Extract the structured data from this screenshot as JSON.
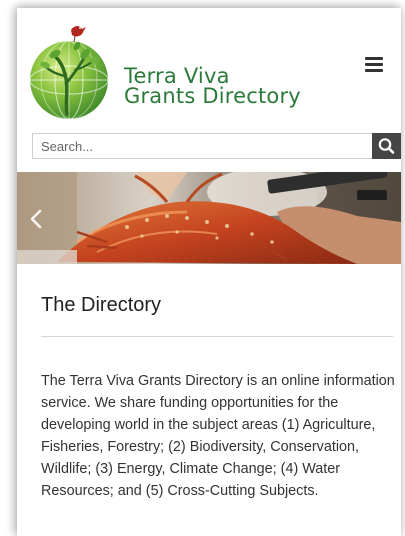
{
  "header": {
    "site_title_line1": "Terra Viva",
    "site_title_line2": "Grants Directory"
  },
  "icons": {
    "logo": "globe-with-tree-and-bird-logo",
    "menu": "hamburger-menu-icon",
    "search": "search-icon",
    "prev": "chevron-left-icon"
  },
  "search": {
    "placeholder": "Search..."
  },
  "hero": {
    "description": "lobster-photo-slide"
  },
  "main": {
    "title": "The Directory",
    "intro": "The Terra Viva Grants Directory is an online information service. We share funding opportunities for the developing world in the subject areas (1) Agriculture, Fisheries, Forestry; (2) Biodiversity, Conservation, Wildlife; (3) Energy, Climate Change; (4) Water Resources; and (5) Cross-Cutting Subjects."
  },
  "colors": {
    "brand_green": "#2b7a3a",
    "search_button": "#454545",
    "text": "#333333"
  }
}
